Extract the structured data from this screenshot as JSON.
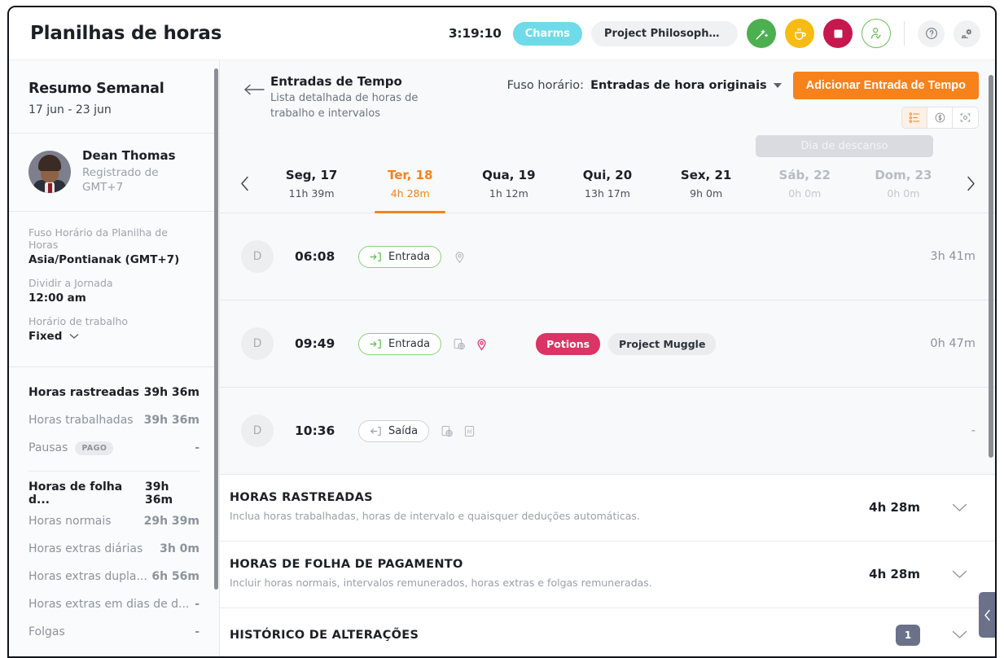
{
  "header": {
    "app_title": "Planilhas de horas",
    "timer": "3:19:10",
    "tag_label": "Charms",
    "project_label": "Project Philosopher's S...",
    "icons": {
      "timer_btn": "wand-start-icon",
      "break_btn": "coffee-cup-icon",
      "stop_btn": "stop-square-icon",
      "user_btn": "user-check-icon",
      "help_btn": "help-circle-icon",
      "settings_btn": "settings-gear-icon"
    },
    "accent_orange": "#f7821b",
    "tag_color": "#6fdbe8",
    "green": "#4caf50",
    "yellow": "#f7bc12",
    "red": "#c6174e"
  },
  "sidebar": {
    "title": "Resumo Semanal",
    "date_range": "17 jun - 23 jun",
    "profile": {
      "name": "Dean Thomas",
      "subtitle": "Registrado de GMT+7"
    },
    "meta": [
      {
        "label": "Fuso Horário da Planilha de Horas",
        "value": "Asia/Pontianak (GMT+7)",
        "caret": false
      },
      {
        "label": "Dividir a Jornada",
        "value": "12:00 am",
        "caret": false
      },
      {
        "label": "Horário de trabalho",
        "value": "Fixed",
        "caret": true
      }
    ],
    "stats_top": [
      {
        "label": "Horas rastreadas",
        "value": "39h 36m",
        "bold": true,
        "badge": null
      },
      {
        "label": "Horas trabalhadas",
        "value": "39h 36m",
        "bold": false,
        "badge": null
      },
      {
        "label": "Pausas",
        "value": "-",
        "bold": false,
        "badge": "PAGO"
      }
    ],
    "stats_bottom": [
      {
        "label": "Horas de folha d...",
        "value": "39h 36m",
        "bold": true,
        "badge": null
      },
      {
        "label": "Horas normais",
        "value": "29h 39m",
        "bold": false,
        "badge": null
      },
      {
        "label": "Horas extras diárias",
        "value": "3h 0m",
        "bold": false,
        "badge": null
      },
      {
        "label": "Horas extras dupla...",
        "value": "6h 56m",
        "bold": false,
        "badge": null
      },
      {
        "label": "Horas extras em dias de d...",
        "value": "-",
        "bold": false,
        "badge": null
      },
      {
        "label": "Folgas",
        "value": "-",
        "bold": false,
        "badge": null
      }
    ]
  },
  "main": {
    "panel_title": "Entradas de Tempo",
    "panel_subtitle": "Lista detalhada de horas de trabalho e intervalos",
    "timezone_prefix": "Fuso horário:",
    "timezone_value": "Entradas de hora originais",
    "add_button": "Adicionar Entrada de Tempo",
    "segments": [
      {
        "name": "list-view",
        "active": true
      },
      {
        "name": "money-view",
        "active": false
      },
      {
        "name": "screenshot-view",
        "active": false
      }
    ],
    "rest_day_label": "Dia de descanso",
    "days": [
      {
        "label": "Seg, 17",
        "hours": "11h 39m",
        "active": false,
        "dim": false
      },
      {
        "label": "Ter, 18",
        "hours": "4h 28m",
        "active": true,
        "dim": false
      },
      {
        "label": "Qua, 19",
        "hours": "1h 12m",
        "active": false,
        "dim": false
      },
      {
        "label": "Qui, 20",
        "hours": "13h 17m",
        "active": false,
        "dim": false
      },
      {
        "label": "Sex, 21",
        "hours": "9h 0m",
        "active": false,
        "dim": false
      },
      {
        "label": "Sáb, 22",
        "hours": "0h 0m",
        "active": false,
        "dim": true
      },
      {
        "label": "Dom, 23",
        "hours": "0h 0m",
        "active": false,
        "dim": true
      }
    ],
    "entries": [
      {
        "avatar_initial": "D",
        "time": "06:08",
        "type": "Entrada",
        "direction": "in",
        "icons": [
          "location-pin-outline-icon"
        ],
        "tags": [],
        "duration": "3h 41m"
      },
      {
        "avatar_initial": "D",
        "time": "09:49",
        "type": "Entrada",
        "direction": "in",
        "icons": [
          "device-globe-icon",
          "location-pin-filled-icon"
        ],
        "tags": [
          {
            "label": "Potions",
            "style": "red"
          },
          {
            "label": "Project Muggle",
            "style": "grey"
          }
        ],
        "duration": "0h 47m"
      },
      {
        "avatar_initial": "D",
        "time": "10:36",
        "type": "Saída",
        "direction": "out",
        "icons": [
          "device-globe-icon",
          "manual-entry-icon"
        ],
        "tags": [],
        "duration": "-"
      }
    ],
    "summaries": [
      {
        "title": "HORAS RASTREADAS",
        "description": "Inclua horas trabalhadas, horas de intervalo e quaisquer deduções automáticas.",
        "value": "4h 28m",
        "badge": null
      },
      {
        "title": "HORAS DE FOLHA DE PAGAMENTO",
        "description": "Incluir horas normais, intervalos remunerados, horas extras e folgas remuneradas.",
        "value": "4h 28m",
        "badge": null
      },
      {
        "title": "HISTÓRICO DE ALTERAÇÕES",
        "description": "",
        "value": "",
        "badge": "1"
      }
    ]
  }
}
